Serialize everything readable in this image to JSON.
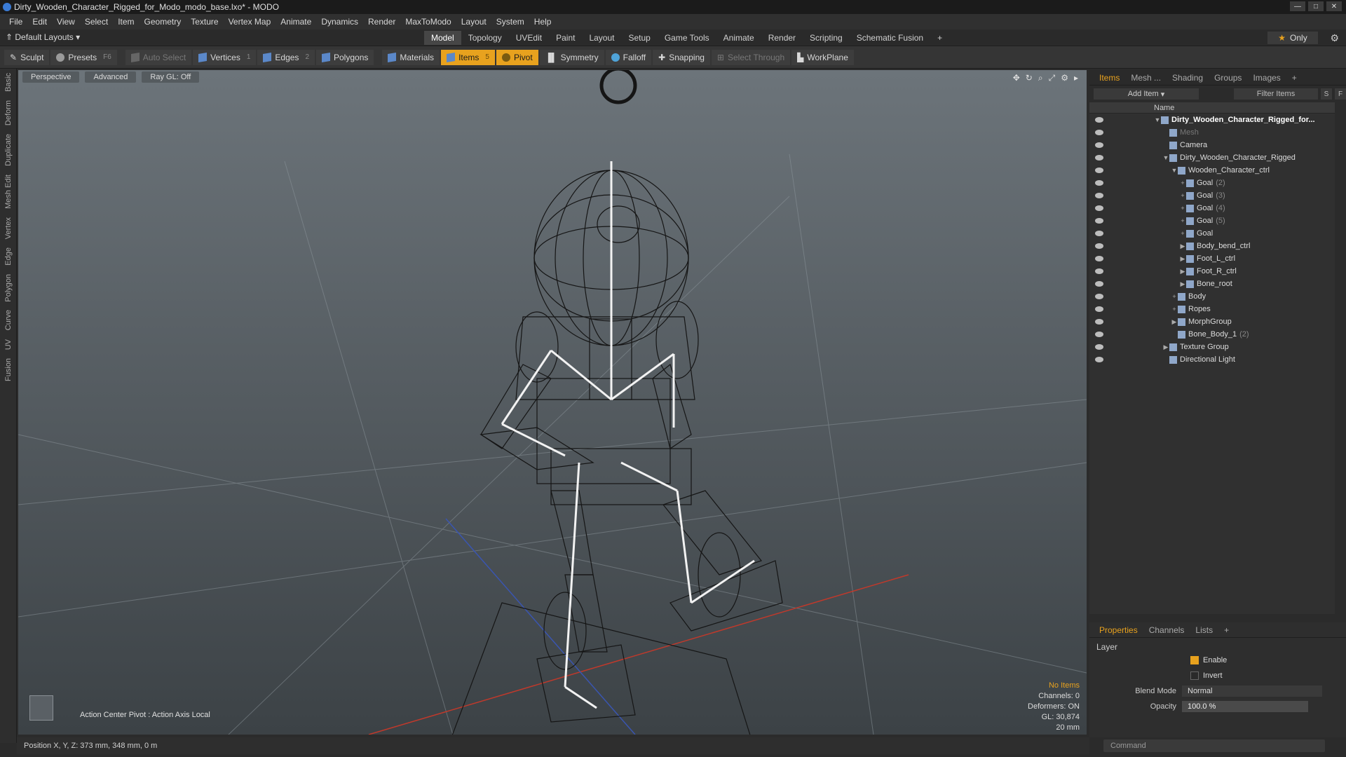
{
  "window": {
    "title": "Dirty_Wooden_Character_Rigged_for_Modo_modo_base.lxo* - MODO"
  },
  "menu": [
    "File",
    "Edit",
    "View",
    "Select",
    "Item",
    "Geometry",
    "Texture",
    "Vertex Map",
    "Animate",
    "Dynamics",
    "Render",
    "MaxToModo",
    "Layout",
    "System",
    "Help"
  ],
  "layoutbar": {
    "layouts_label": "Default Layouts",
    "tabs": [
      "Model",
      "Topology",
      "UVEdit",
      "Paint",
      "Layout",
      "Setup",
      "Game Tools",
      "Animate",
      "Render",
      "Scripting",
      "Schematic Fusion"
    ],
    "active_tab": "Model",
    "only_label": "Only"
  },
  "toolbar": {
    "sculpt": "Sculpt",
    "presets": "Presets",
    "presets_key": "F6",
    "auto_select": "Auto Select",
    "vertices": "Vertices",
    "vertices_key": "1",
    "edges": "Edges",
    "edges_key": "2",
    "polygons": "Polygons",
    "materials": "Materials",
    "items": "Items",
    "pivot": "Pivot",
    "symmetry": "Symmetry",
    "falloff": "Falloff",
    "snapping": "Snapping",
    "select_through": "Select Through",
    "workplane": "WorkPlane"
  },
  "left_tabs": [
    "Basic",
    "Deform",
    "Duplicate",
    "Mesh Edit",
    "Vertex",
    "Edge",
    "Polygon",
    "Curve",
    "UV",
    "Fusion"
  ],
  "viewport": {
    "perspective": "Perspective",
    "advanced": "Advanced",
    "raygl": "Ray GL: Off",
    "action_center": "Action Center Pivot : Action Axis Local",
    "stats": {
      "no_items": "No Items",
      "channels": "Channels: 0",
      "deformers": "Deformers: ON",
      "gl": "GL: 30,874",
      "size": "20 mm"
    }
  },
  "statusbar": {
    "position": "Position X, Y, Z:  373 mm, 348 mm, 0 m"
  },
  "right_panel": {
    "tabs": [
      "Items",
      "Mesh ...",
      "Shading",
      "Groups",
      "Images"
    ],
    "active_tab": "Items",
    "add_item": "Add Item",
    "filter_items": "Filter Items",
    "s_btn": "S",
    "f_btn": "F",
    "name_header": "Name",
    "tree": [
      {
        "label": "Dirty_Wooden_Character_Rigged_for...",
        "suffix": "",
        "indent": 0,
        "arrow": "▼",
        "style": "bold"
      },
      {
        "label": "Mesh",
        "suffix": "",
        "indent": 1,
        "arrow": "",
        "style": "dim"
      },
      {
        "label": "Camera",
        "suffix": "",
        "indent": 1,
        "arrow": "",
        "style": ""
      },
      {
        "label": "Dirty_Wooden_Character_Rigged",
        "suffix": "",
        "indent": 1,
        "arrow": "▼",
        "style": ""
      },
      {
        "label": "Wooden_Character_ctrl",
        "suffix": "",
        "indent": 2,
        "arrow": "▼",
        "style": ""
      },
      {
        "label": "Goal",
        "suffix": "(2)",
        "indent": 3,
        "arrow": "+",
        "style": ""
      },
      {
        "label": "Goal",
        "suffix": "(3)",
        "indent": 3,
        "arrow": "+",
        "style": ""
      },
      {
        "label": "Goal",
        "suffix": "(4)",
        "indent": 3,
        "arrow": "+",
        "style": ""
      },
      {
        "label": "Goal",
        "suffix": "(5)",
        "indent": 3,
        "arrow": "+",
        "style": ""
      },
      {
        "label": "Goal",
        "suffix": "",
        "indent": 3,
        "arrow": "+",
        "style": ""
      },
      {
        "label": "Body_bend_ctrl",
        "suffix": "",
        "indent": 3,
        "arrow": "▶",
        "style": ""
      },
      {
        "label": "Foot_L_ctrl",
        "suffix": "",
        "indent": 3,
        "arrow": "▶",
        "style": ""
      },
      {
        "label": "Foot_R_ctrl",
        "suffix": "",
        "indent": 3,
        "arrow": "▶",
        "style": ""
      },
      {
        "label": "Bone_root",
        "suffix": "",
        "indent": 3,
        "arrow": "▶",
        "style": ""
      },
      {
        "label": "Body",
        "suffix": "",
        "indent": 2,
        "arrow": "+",
        "style": ""
      },
      {
        "label": "Ropes",
        "suffix": "",
        "indent": 2,
        "arrow": "+",
        "style": ""
      },
      {
        "label": "MorphGroup",
        "suffix": "",
        "indent": 2,
        "arrow": "▶",
        "style": ""
      },
      {
        "label": "Bone_Body_1",
        "suffix": "(2)",
        "indent": 2,
        "arrow": "",
        "style": ""
      },
      {
        "label": "Texture Group",
        "suffix": "",
        "indent": 1,
        "arrow": "▶",
        "style": ""
      },
      {
        "label": "Directional Light",
        "suffix": "",
        "indent": 1,
        "arrow": "",
        "style": ""
      }
    ]
  },
  "properties": {
    "tabs": [
      "Properties",
      "Channels",
      "Lists"
    ],
    "active_tab": "Properties",
    "section": "Layer",
    "enable_label": "Enable",
    "enable_checked": true,
    "invert_label": "Invert",
    "invert_checked": false,
    "blend_mode_label": "Blend Mode",
    "blend_mode_value": "Normal",
    "opacity_label": "Opacity",
    "opacity_value": "100.0 %"
  },
  "command": {
    "placeholder": "Command"
  },
  "colors": {
    "accent": "#e8a21e",
    "panel": "#2b2b2b",
    "viewport_top": "#6c747a",
    "viewport_bottom": "#3c4246"
  }
}
